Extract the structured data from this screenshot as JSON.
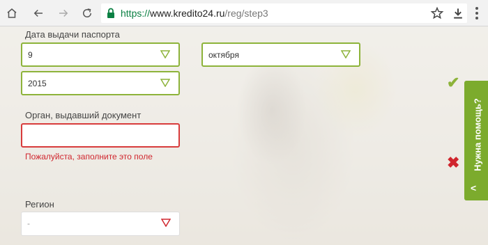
{
  "browser": {
    "url_scheme": "https://",
    "url_host": "www.kredito24.ru",
    "url_path": "/reg/step3",
    "icons": [
      "home-icon",
      "back-icon",
      "forward-icon",
      "reload-icon",
      "lock-icon",
      "star-icon",
      "download-icon",
      "menu-icon"
    ]
  },
  "form": {
    "passport_date_label": "Дата выдачи паспорта",
    "day_value": "9",
    "month_value": "октября",
    "year_value": "2015",
    "issuer_label": "Орган, выдавший документ",
    "issuer_value": "",
    "issuer_error": "Пожалуйста, заполните это поле",
    "region_label": "Регион",
    "region_value": "-"
  },
  "help": {
    "label": "Нужна помощь?",
    "arrow": "<"
  },
  "status": {
    "valid_icon": "check-icon",
    "invalid_icon": "cross-icon",
    "check_glyph": "✔",
    "cross_glyph": "✖"
  },
  "colors": {
    "accent_green": "#8db33a",
    "error_red": "#d0262e",
    "help_green": "#7cab2d"
  }
}
